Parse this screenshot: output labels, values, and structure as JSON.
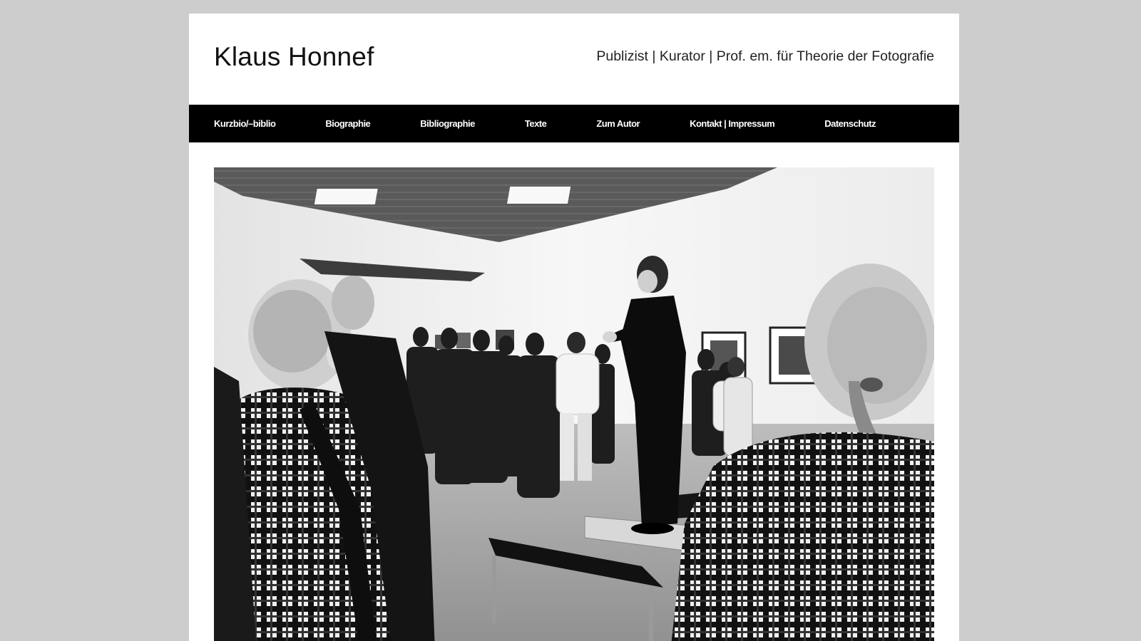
{
  "site": {
    "title": "Klaus Honnef",
    "tagline": "Publizist | Kurator | Prof. em. für Theorie der Fotografie"
  },
  "nav": {
    "items": [
      {
        "label": "Kurzbio/–biblio"
      },
      {
        "label": "Biographie"
      },
      {
        "label": "Bibliographie"
      },
      {
        "label": "Texte"
      },
      {
        "label": "Zum Autor"
      },
      {
        "label": "Kontakt | Impressum"
      },
      {
        "label": "Datenschutz"
      }
    ]
  },
  "hero": {
    "kind": "black-and-white photograph",
    "colors": {
      "ink": "#111111",
      "paper": "#f2f2f2"
    }
  }
}
